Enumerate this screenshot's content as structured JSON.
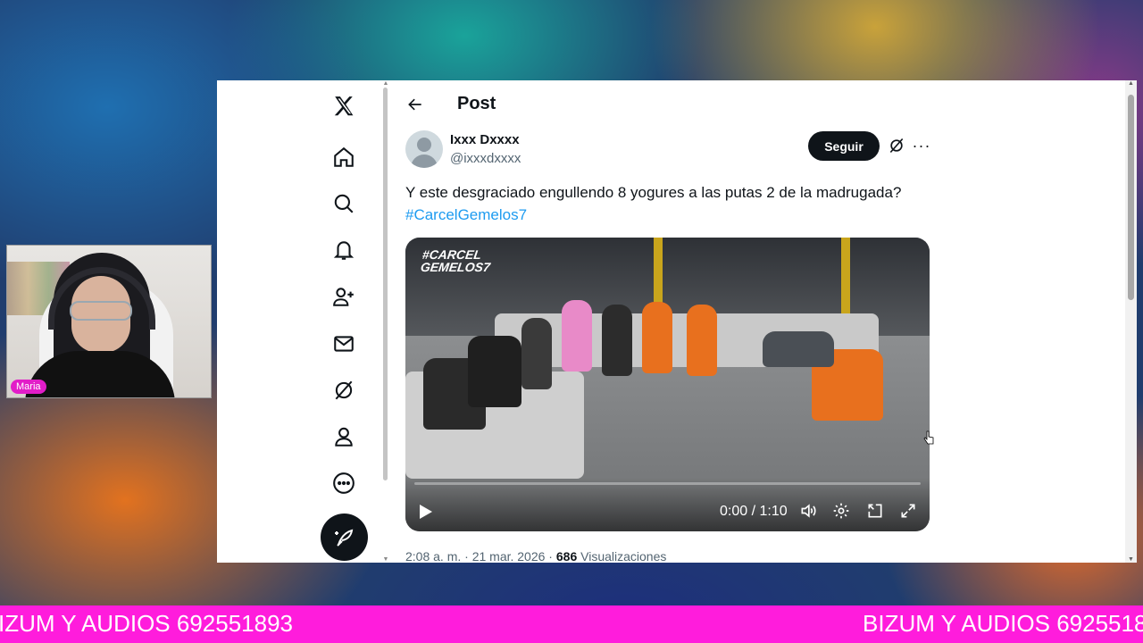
{
  "webcam": {
    "name_tag": "Maria"
  },
  "nav": {
    "items": [
      {
        "icon": "x-logo-icon"
      },
      {
        "icon": "home-icon"
      },
      {
        "icon": "search-icon"
      },
      {
        "icon": "bell-icon"
      },
      {
        "icon": "people-icon"
      },
      {
        "icon": "mail-icon"
      },
      {
        "icon": "grok-icon"
      },
      {
        "icon": "profile-icon"
      },
      {
        "icon": "more-circle-icon"
      }
    ],
    "compose_icon": "feather-icon"
  },
  "header": {
    "title": "Post",
    "back_icon": "arrow-left-icon"
  },
  "tweet": {
    "display_name": "Ixxx Dxxxx",
    "handle": "@ixxxdxxxx",
    "follow_label": "Seguir",
    "text": "Y este desgraciado engullendo 8 yogures a las putas 2 de la madrugada?",
    "hashtag": "#CarcelGemelos7",
    "video": {
      "logo_line1": "#CARCEL",
      "logo_line2": "GEMELOS7",
      "time": "0:00 / 1:10",
      "progress": 0
    },
    "timestamp": "2:08 a. m. · 21 mar. 2026 · ",
    "views_count": "686",
    "views_label": " Visualizaciones"
  },
  "ticker": {
    "left_text": "IZUM Y AUDIOS 692551893",
    "right_text": "BIZUM Y AUDIOS 6925518"
  },
  "colors": {
    "accent": "#1d9bf0",
    "ticker_bg": "#ff1cdc",
    "name_tag_bg": "#e21dc8",
    "follow_bg": "#0f1419"
  }
}
